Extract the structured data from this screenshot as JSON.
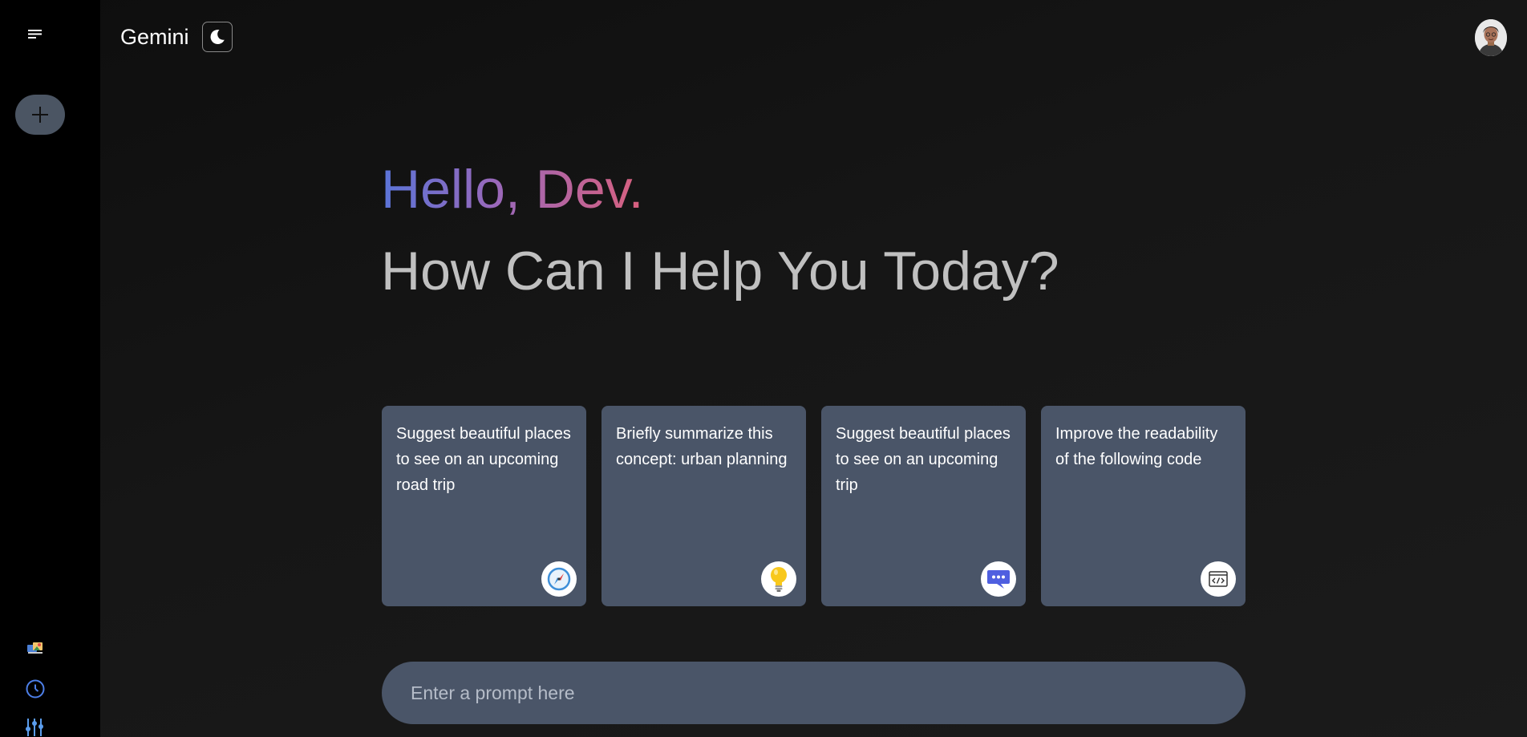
{
  "app": {
    "title": "Gemini"
  },
  "header": {
    "theme_icon": "moon-icon",
    "avatar": "user-avatar"
  },
  "sidebar": {
    "menu_icon": "hamburger-menu-icon",
    "new_chat_icon": "plus-icon",
    "bottom_icons": [
      "gallery-icon",
      "history-icon",
      "settings-sliders-icon"
    ]
  },
  "greeting": {
    "hello": "Hello, Dev.",
    "subtitle": "How Can I Help You Today?"
  },
  "cards": [
    {
      "text": "Suggest beautiful places to see on an upcoming road trip",
      "icon": "compass-icon"
    },
    {
      "text": "Briefly summarize this concept: urban planning",
      "icon": "lightbulb-icon"
    },
    {
      "text": "Suggest beautiful places to see on an upcoming trip",
      "icon": "chat-bubble-icon"
    },
    {
      "text": "Improve the readability of the following code",
      "icon": "code-icon"
    }
  ],
  "prompt": {
    "placeholder": "Enter a prompt here",
    "value": ""
  },
  "colors": {
    "sidebar_bg": "#000000",
    "card_bg": "#4a5568",
    "gradient_start": "#5a74d8",
    "gradient_end": "#d9607d",
    "subtitle": "#c0c0c0"
  }
}
